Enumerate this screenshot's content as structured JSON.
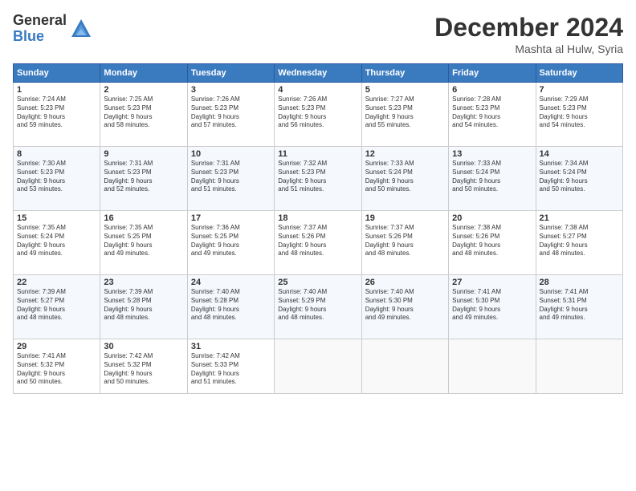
{
  "logo": {
    "general": "General",
    "blue": "Blue"
  },
  "header": {
    "month": "December 2024",
    "location": "Mashta al Hulw, Syria"
  },
  "weekdays": [
    "Sunday",
    "Monday",
    "Tuesday",
    "Wednesday",
    "Thursday",
    "Friday",
    "Saturday"
  ],
  "weeks": [
    [
      {
        "day": "1",
        "sunrise": "7:24 AM",
        "sunset": "5:23 PM",
        "daylight": "9 hours and 59 minutes."
      },
      {
        "day": "2",
        "sunrise": "7:25 AM",
        "sunset": "5:23 PM",
        "daylight": "9 hours and 58 minutes."
      },
      {
        "day": "3",
        "sunrise": "7:26 AM",
        "sunset": "5:23 PM",
        "daylight": "9 hours and 57 minutes."
      },
      {
        "day": "4",
        "sunrise": "7:26 AM",
        "sunset": "5:23 PM",
        "daylight": "9 hours and 56 minutes."
      },
      {
        "day": "5",
        "sunrise": "7:27 AM",
        "sunset": "5:23 PM",
        "daylight": "9 hours and 55 minutes."
      },
      {
        "day": "6",
        "sunrise": "7:28 AM",
        "sunset": "5:23 PM",
        "daylight": "9 hours and 54 minutes."
      },
      {
        "day": "7",
        "sunrise": "7:29 AM",
        "sunset": "5:23 PM",
        "daylight": "9 hours and 54 minutes."
      }
    ],
    [
      {
        "day": "8",
        "sunrise": "7:30 AM",
        "sunset": "5:23 PM",
        "daylight": "9 hours and 53 minutes."
      },
      {
        "day": "9",
        "sunrise": "7:31 AM",
        "sunset": "5:23 PM",
        "daylight": "9 hours and 52 minutes."
      },
      {
        "day": "10",
        "sunrise": "7:31 AM",
        "sunset": "5:23 PM",
        "daylight": "9 hours and 51 minutes."
      },
      {
        "day": "11",
        "sunrise": "7:32 AM",
        "sunset": "5:23 PM",
        "daylight": "9 hours and 51 minutes."
      },
      {
        "day": "12",
        "sunrise": "7:33 AM",
        "sunset": "5:24 PM",
        "daylight": "9 hours and 50 minutes."
      },
      {
        "day": "13",
        "sunrise": "7:33 AM",
        "sunset": "5:24 PM",
        "daylight": "9 hours and 50 minutes."
      },
      {
        "day": "14",
        "sunrise": "7:34 AM",
        "sunset": "5:24 PM",
        "daylight": "9 hours and 50 minutes."
      }
    ],
    [
      {
        "day": "15",
        "sunrise": "7:35 AM",
        "sunset": "5:24 PM",
        "daylight": "9 hours and 49 minutes."
      },
      {
        "day": "16",
        "sunrise": "7:35 AM",
        "sunset": "5:25 PM",
        "daylight": "9 hours and 49 minutes."
      },
      {
        "day": "17",
        "sunrise": "7:36 AM",
        "sunset": "5:25 PM",
        "daylight": "9 hours and 49 minutes."
      },
      {
        "day": "18",
        "sunrise": "7:37 AM",
        "sunset": "5:26 PM",
        "daylight": "9 hours and 48 minutes."
      },
      {
        "day": "19",
        "sunrise": "7:37 AM",
        "sunset": "5:26 PM",
        "daylight": "9 hours and 48 minutes."
      },
      {
        "day": "20",
        "sunrise": "7:38 AM",
        "sunset": "5:26 PM",
        "daylight": "9 hours and 48 minutes."
      },
      {
        "day": "21",
        "sunrise": "7:38 AM",
        "sunset": "5:27 PM",
        "daylight": "9 hours and 48 minutes."
      }
    ],
    [
      {
        "day": "22",
        "sunrise": "7:39 AM",
        "sunset": "5:27 PM",
        "daylight": "9 hours and 48 minutes."
      },
      {
        "day": "23",
        "sunrise": "7:39 AM",
        "sunset": "5:28 PM",
        "daylight": "9 hours and 48 minutes."
      },
      {
        "day": "24",
        "sunrise": "7:40 AM",
        "sunset": "5:28 PM",
        "daylight": "9 hours and 48 minutes."
      },
      {
        "day": "25",
        "sunrise": "7:40 AM",
        "sunset": "5:29 PM",
        "daylight": "9 hours and 48 minutes."
      },
      {
        "day": "26",
        "sunrise": "7:40 AM",
        "sunset": "5:30 PM",
        "daylight": "9 hours and 49 minutes."
      },
      {
        "day": "27",
        "sunrise": "7:41 AM",
        "sunset": "5:30 PM",
        "daylight": "9 hours and 49 minutes."
      },
      {
        "day": "28",
        "sunrise": "7:41 AM",
        "sunset": "5:31 PM",
        "daylight": "9 hours and 49 minutes."
      }
    ],
    [
      {
        "day": "29",
        "sunrise": "7:41 AM",
        "sunset": "5:32 PM",
        "daylight": "9 hours and 50 minutes."
      },
      {
        "day": "30",
        "sunrise": "7:42 AM",
        "sunset": "5:32 PM",
        "daylight": "9 hours and 50 minutes."
      },
      {
        "day": "31",
        "sunrise": "7:42 AM",
        "sunset": "5:33 PM",
        "daylight": "9 hours and 51 minutes."
      },
      null,
      null,
      null,
      null
    ]
  ]
}
